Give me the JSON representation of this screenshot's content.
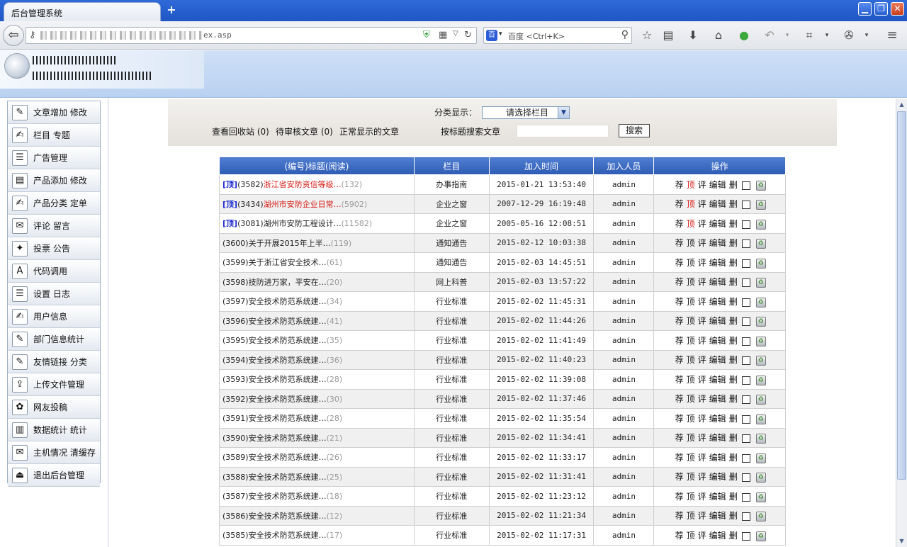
{
  "browser": {
    "tab_title": "后台管理系统",
    "new_tab": "+",
    "url_suffix": "ex.asp",
    "search_engine": "百度 <Ctrl+K>"
  },
  "filter": {
    "label": "分类显示：",
    "select_value": "请选择栏目"
  },
  "links": {
    "recycle": "查看回收站 (0)",
    "pending": "待审核文章 (0)",
    "normal": "正常显示的文章",
    "search_label": "按标题搜索文章",
    "search_button": "搜索"
  },
  "sidebar": [
    {
      "icon": "edit-doc-icon",
      "glyph": "✎",
      "label": "文章增加  修改"
    },
    {
      "icon": "pen-icon",
      "glyph": "✍",
      "label": "栏目  专题"
    },
    {
      "icon": "list-icon",
      "glyph": "☰",
      "label": "广告管理"
    },
    {
      "icon": "book-icon",
      "glyph": "▤",
      "label": "产品添加  修改"
    },
    {
      "icon": "pen-icon",
      "glyph": "✍",
      "label": "产品分类  定单"
    },
    {
      "icon": "comment-icon",
      "glyph": "✉",
      "label": "评论  留言"
    },
    {
      "icon": "vote-icon",
      "glyph": "✦",
      "label": "投票  公告"
    },
    {
      "icon": "code-icon",
      "glyph": "A",
      "label": "代码调用"
    },
    {
      "icon": "settings-icon",
      "glyph": "☰",
      "label": "设置  日志"
    },
    {
      "icon": "user-icon",
      "glyph": "✍",
      "label": "用户信息"
    },
    {
      "icon": "stats-icon",
      "glyph": "✎",
      "label": "部门信息统计"
    },
    {
      "icon": "link-icon",
      "glyph": "✎",
      "label": "友情链接  分类"
    },
    {
      "icon": "upload-icon",
      "glyph": "⇪",
      "label": "上传文件管理"
    },
    {
      "icon": "submit-icon",
      "glyph": "✿",
      "label": "网友投稿"
    },
    {
      "icon": "data-icon",
      "glyph": "▥",
      "label": "数据统计  统计"
    },
    {
      "icon": "server-icon",
      "glyph": "✉",
      "label": "主机情况  清缓存"
    },
    {
      "icon": "exit-icon",
      "glyph": "⏏",
      "label": "退出后台管理"
    }
  ],
  "table": {
    "headers": [
      "(编号)标题(阅读)",
      "栏目",
      "加入时间",
      "加入人员",
      "操作"
    ],
    "actions": {
      "recommend": "荐",
      "top": "顶",
      "comment": "评",
      "edit": "编辑",
      "delete": "删"
    },
    "rows": [
      {
        "top": "[顶]",
        "id": "(3582)",
        "title": "浙江省安防资信等级…",
        "reads": "(132)",
        "category": "办事指南",
        "time": "2015-01-21 13:53:40",
        "user": "admin",
        "red_title": true,
        "top_red": true
      },
      {
        "top": "[顶]",
        "id": "(3434)",
        "title": "湖州市安防企业日常…",
        "reads": "(5902)",
        "category": "企业之窗",
        "time": "2007-12-29 16:19:48",
        "user": "admin",
        "red_title": true,
        "top_red": true
      },
      {
        "top": "[顶]",
        "id": "(3081)",
        "title": "湖州市安防工程设计…",
        "reads": "(11582)",
        "category": "企业之窗",
        "time": "2005-05-16 12:08:51",
        "user": "admin",
        "red_title": false,
        "top_red": true
      },
      {
        "top": "",
        "id": "(3600)",
        "title": "关于开展2015年上半…",
        "reads": "(119)",
        "category": "通知通告",
        "time": "2015-02-12 10:03:38",
        "user": "admin",
        "red_title": false,
        "top_red": false
      },
      {
        "top": "",
        "id": "(3599)",
        "title": "关于浙江省安全技术…",
        "reads": "(61)",
        "category": "通知通告",
        "time": "2015-02-03 14:45:51",
        "user": "admin",
        "red_title": false,
        "top_red": false
      },
      {
        "top": "",
        "id": "(3598)",
        "title": "技防进万家，平安在…",
        "reads": "(20)",
        "category": "网上科普",
        "time": "2015-02-03 13:57:22",
        "user": "admin",
        "red_title": false,
        "top_red": false
      },
      {
        "top": "",
        "id": "(3597)",
        "title": "安全技术防范系统建…",
        "reads": "(34)",
        "category": "行业标准",
        "time": "2015-02-02 11:45:31",
        "user": "admin",
        "red_title": false,
        "top_red": false
      },
      {
        "top": "",
        "id": "(3596)",
        "title": "安全技术防范系统建…",
        "reads": "(41)",
        "category": "行业标准",
        "time": "2015-02-02 11:44:26",
        "user": "admin",
        "red_title": false,
        "top_red": false
      },
      {
        "top": "",
        "id": "(3595)",
        "title": "安全技术防范系统建…",
        "reads": "(35)",
        "category": "行业标准",
        "time": "2015-02-02 11:41:49",
        "user": "admin",
        "red_title": false,
        "top_red": false
      },
      {
        "top": "",
        "id": "(3594)",
        "title": "安全技术防范系统建…",
        "reads": "(36)",
        "category": "行业标准",
        "time": "2015-02-02 11:40:23",
        "user": "admin",
        "red_title": false,
        "top_red": false
      },
      {
        "top": "",
        "id": "(3593)",
        "title": "安全技术防范系统建…",
        "reads": "(28)",
        "category": "行业标准",
        "time": "2015-02-02 11:39:08",
        "user": "admin",
        "red_title": false,
        "top_red": false
      },
      {
        "top": "",
        "id": "(3592)",
        "title": "安全技术防范系统建…",
        "reads": "(30)",
        "category": "行业标准",
        "time": "2015-02-02 11:37:46",
        "user": "admin",
        "red_title": false,
        "top_red": false
      },
      {
        "top": "",
        "id": "(3591)",
        "title": "安全技术防范系统建…",
        "reads": "(28)",
        "category": "行业标准",
        "time": "2015-02-02 11:35:54",
        "user": "admin",
        "red_title": false,
        "top_red": false
      },
      {
        "top": "",
        "id": "(3590)",
        "title": "安全技术防范系统建…",
        "reads": "(21)",
        "category": "行业标准",
        "time": "2015-02-02 11:34:41",
        "user": "admin",
        "red_title": false,
        "top_red": false
      },
      {
        "top": "",
        "id": "(3589)",
        "title": "安全技术防范系统建…",
        "reads": "(26)",
        "category": "行业标准",
        "time": "2015-02-02 11:33:17",
        "user": "admin",
        "red_title": false,
        "top_red": false
      },
      {
        "top": "",
        "id": "(3588)",
        "title": "安全技术防范系统建…",
        "reads": "(25)",
        "category": "行业标准",
        "time": "2015-02-02 11:31:41",
        "user": "admin",
        "red_title": false,
        "top_red": false
      },
      {
        "top": "",
        "id": "(3587)",
        "title": "安全技术防范系统建…",
        "reads": "(18)",
        "category": "行业标准",
        "time": "2015-02-02 11:23:12",
        "user": "admin",
        "red_title": false,
        "top_red": false
      },
      {
        "top": "",
        "id": "(3586)",
        "title": "安全技术防范系统建…",
        "reads": "(12)",
        "category": "行业标准",
        "time": "2015-02-02 11:21:34",
        "user": "admin",
        "red_title": false,
        "top_red": false
      },
      {
        "top": "",
        "id": "(3585)",
        "title": "安全技术防范系统建…",
        "reads": "(17)",
        "category": "行业标准",
        "time": "2015-02-02 11:17:31",
        "user": "admin",
        "red_title": false,
        "top_red": false
      }
    ]
  }
}
